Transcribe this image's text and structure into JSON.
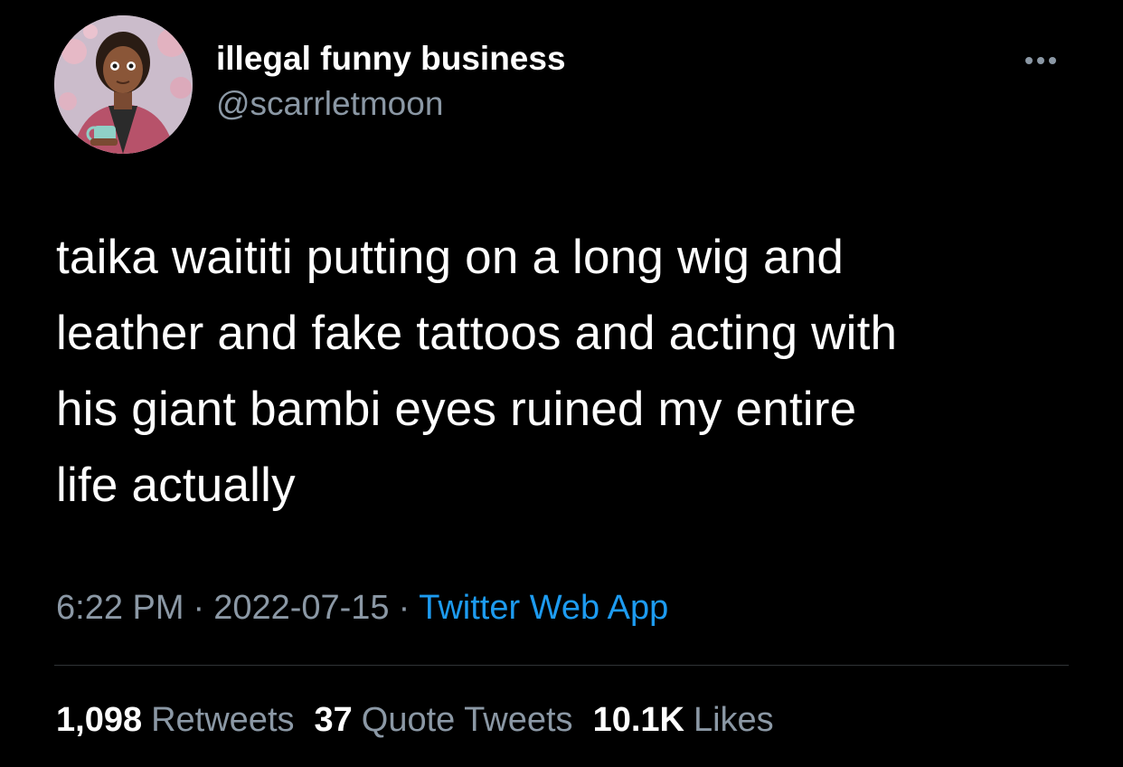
{
  "tweet": {
    "author": {
      "display_name": "illegal funny business",
      "handle": "@scarrletmoon",
      "avatar_icon": "cartoon-avatar"
    },
    "more_icon": "more-horizontal-icon",
    "text_lines": [
      "taika waititi putting on a long wig and",
      "leather and fake tattoos and acting with",
      "his giant bambi eyes ruined my entire",
      "life actually"
    ],
    "meta": {
      "time": "6:22 PM",
      "separator": "·",
      "date": "2022-07-15",
      "source": "Twitter Web App"
    },
    "stats": {
      "retweets_count": "1,098",
      "retweets_label": "Retweets",
      "quotes_count": "37",
      "quotes_label": "Quote Tweets",
      "likes_count": "10.1K",
      "likes_label": "Likes"
    }
  },
  "colors": {
    "background": "#000000",
    "primary_text": "#ffffff",
    "secondary_text": "#8b98a5",
    "link": "#1d9bf0",
    "divider": "#2f3336"
  }
}
